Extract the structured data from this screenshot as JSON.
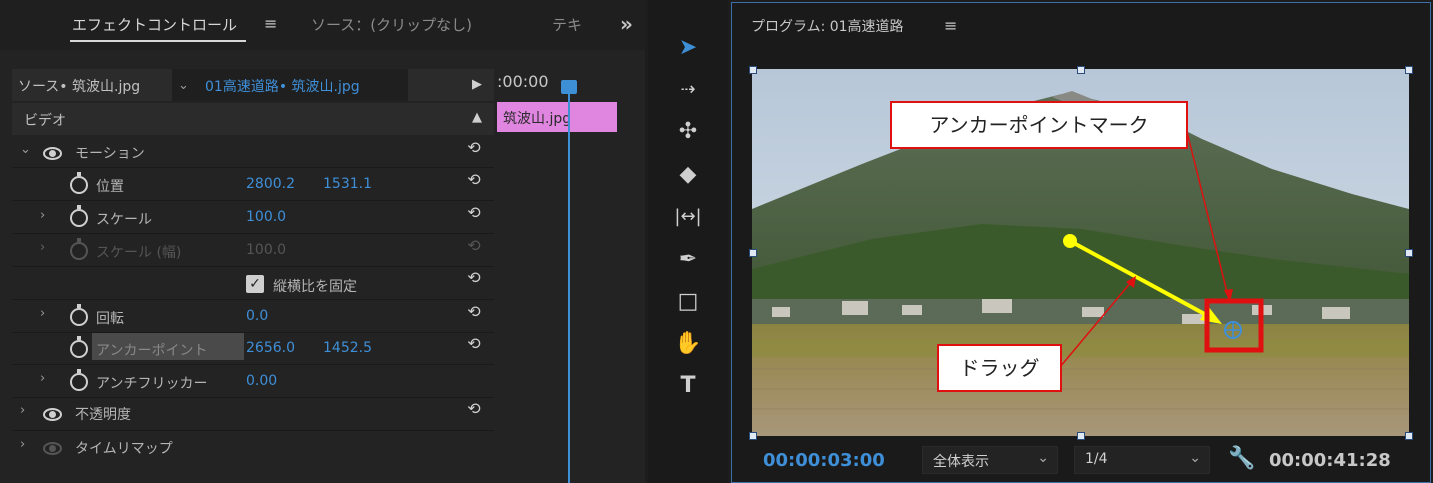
{
  "effect_controls": {
    "tabs": [
      {
        "label": "エフェクトコントロール",
        "menu": "≡"
      },
      {
        "label": "ソース：(クリップなし)"
      },
      {
        "label": "テキ"
      }
    ],
    "overflow": "»",
    "source_label": "ソース• 筑波山.jpg",
    "sequence_label": "01高速道路• 筑波山.jpg",
    "play_arrow": "▶",
    "section_video": "ビデオ",
    "motion": {
      "label": "モーション",
      "properties": [
        {
          "name": "位置",
          "v1": "2800.2",
          "v2": "1531.1"
        },
        {
          "name": "スケール",
          "v1": "100.0"
        },
        {
          "name": "スケール (幅)",
          "v1": "100.0",
          "disabled": true
        },
        {
          "checkbox_label": "縦横比を固定",
          "checked": true
        },
        {
          "name": "回転",
          "v1": "0.0"
        },
        {
          "name": "アンカーポイント",
          "v1": "2656.0",
          "v2": "1452.5",
          "highlighted": true
        },
        {
          "name": "アンチフリッカー",
          "v1": "0.00"
        }
      ]
    },
    "opacity_label": "不透明度",
    "time_remap_label": "タイムリマップ",
    "timeline": {
      "timecode": ":00:00",
      "clip_label": "筑波山.jpg"
    }
  },
  "tools": [
    "selection-tool",
    "track-select-tool",
    "ripple-edit-tool",
    "razor-tool",
    "slip-tool",
    "pen-tool",
    "rectangle-tool",
    "hand-tool",
    "type-tool"
  ],
  "program_monitor": {
    "title": "プログラム: 01高速道路",
    "menu": "≡",
    "current_timecode": "00:00:03:00",
    "zoom": "全体表示",
    "resolution": "1/4",
    "duration": "00:00:41:28",
    "annotations": {
      "anchor_label": "アンカーポイントマーク",
      "drag_label": "ドラッグ"
    }
  },
  "colors": {
    "accent_blue": "#3f8fd8",
    "clip_pink": "#e085e0",
    "callout_red": "#e01010",
    "arrow_yellow": "#ffff00"
  }
}
